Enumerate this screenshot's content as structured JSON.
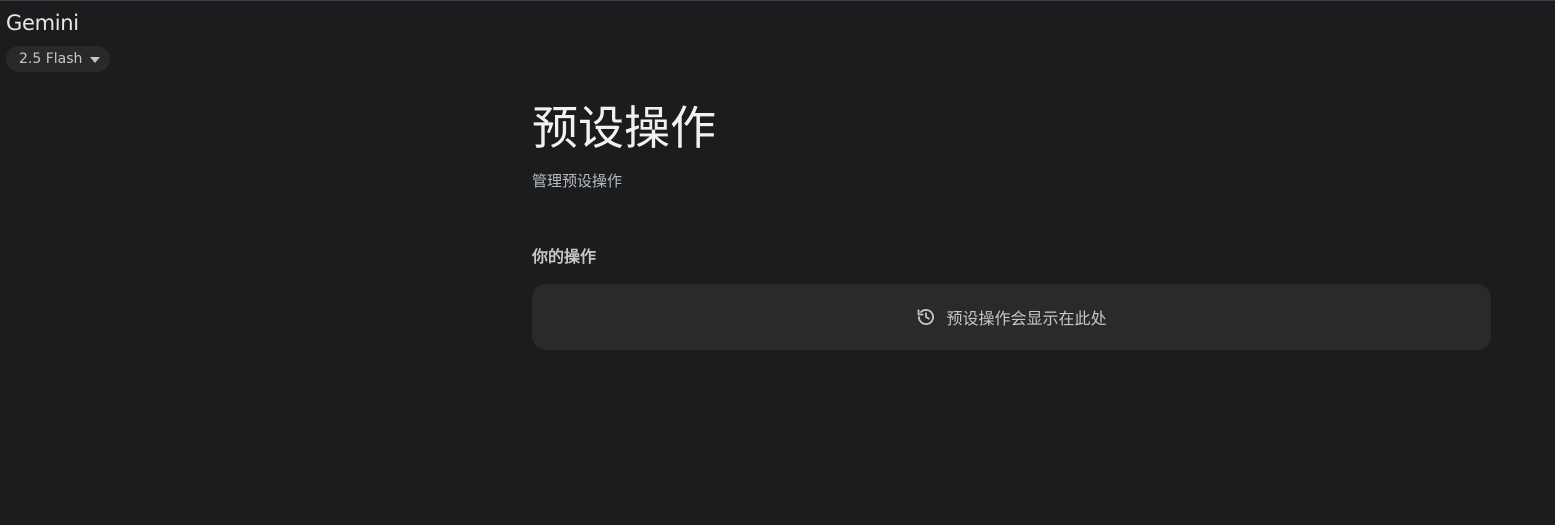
{
  "app": {
    "title": "Gemini"
  },
  "model_switcher": {
    "label": "2.5 Flash",
    "icon": "caret-down-icon"
  },
  "page": {
    "title": "预设操作",
    "subtitle": "管理预设操作"
  },
  "actions_section": {
    "heading": "你的操作",
    "empty_state": {
      "icon": "history-icon",
      "text": "预设操作会显示在此处"
    }
  }
}
